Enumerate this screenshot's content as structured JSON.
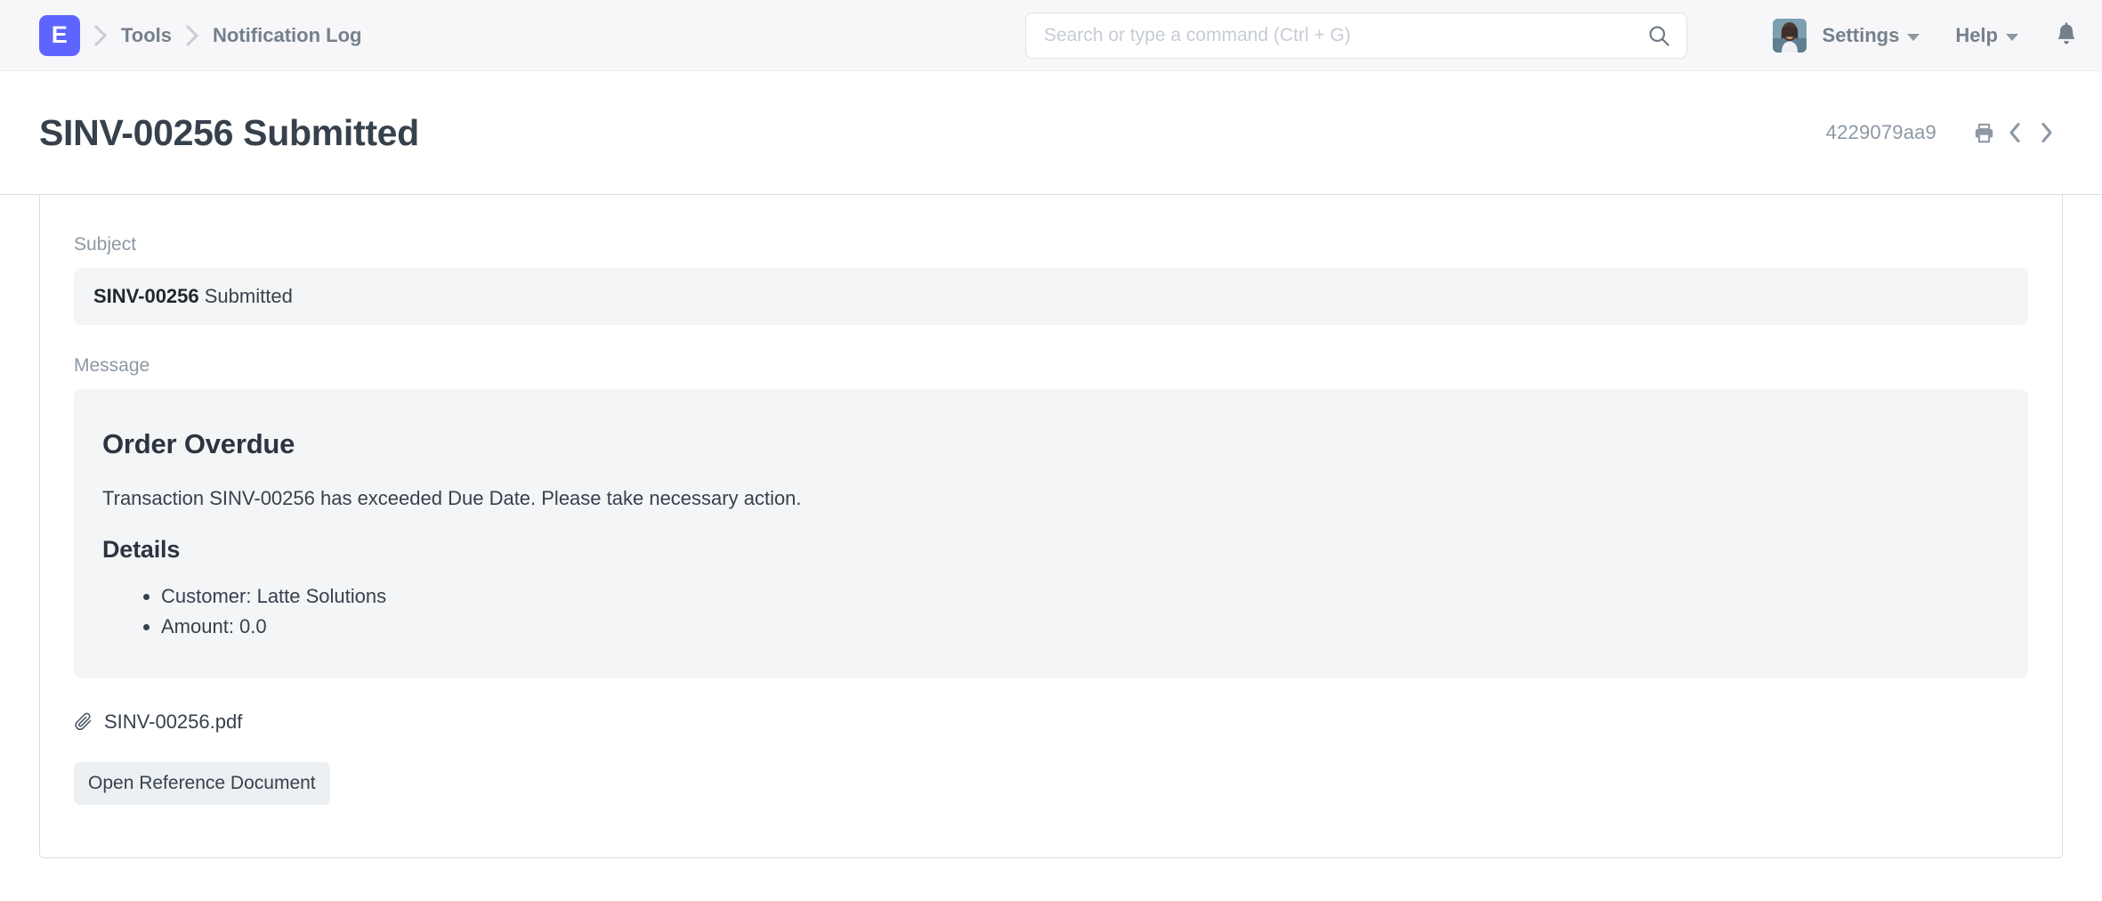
{
  "navbar": {
    "logo_letter": "E",
    "breadcrumbs": [
      {
        "label": "Tools"
      },
      {
        "label": "Notification Log"
      }
    ],
    "search": {
      "value": "",
      "placeholder": "Search or type a command (Ctrl + G)",
      "icon": "search-icon"
    },
    "settings_label": "Settings",
    "help_label": "Help",
    "notifications_icon": "bell-icon",
    "avatar_icon": "user-avatar"
  },
  "page": {
    "title": "SINV-00256 Submitted",
    "doc_id": "4229079aa9",
    "print_icon": "printer-icon",
    "prev_icon": "chevron-left-icon",
    "next_icon": "chevron-right-icon"
  },
  "form": {
    "subject": {
      "label": "Subject",
      "value_bold": "SINV-00256",
      "value_rest": " Submitted"
    },
    "message": {
      "label": "Message",
      "heading": "Order Overdue",
      "paragraph": "Transaction SINV-00256 has exceeded Due Date. Please take necessary action.",
      "details_heading": "Details",
      "details": [
        "Customer: Latte Solutions",
        "Amount: 0.0"
      ]
    },
    "attachment": {
      "icon": "paperclip-icon",
      "filename": "SINV-00256.pdf"
    },
    "reference_button_label": "Open Reference Document"
  },
  "colors": {
    "brand": "#5e64ff",
    "text": "#36414c",
    "muted": "#8d98a4",
    "panel": "#f4f5f7",
    "navbar_bg": "#f7f7f9",
    "border": "#d8dde4"
  }
}
